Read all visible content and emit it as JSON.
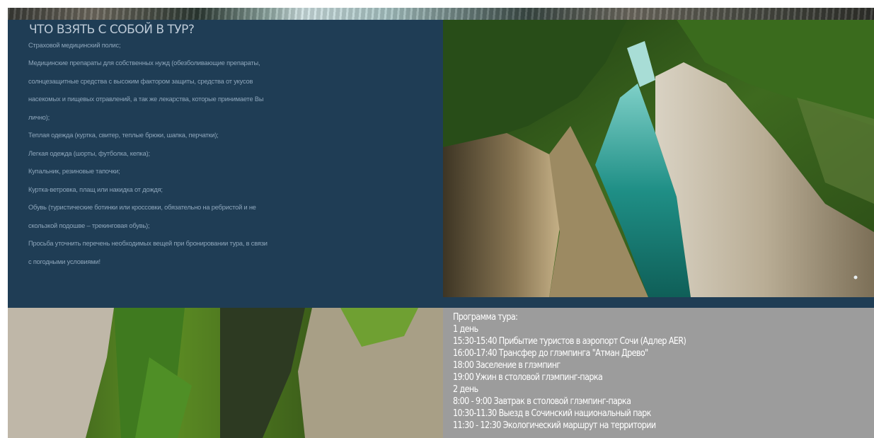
{
  "checklist": {
    "title": "ЧТО ВЗЯТЬ С СОБОЙ В ТУР?",
    "lines": [
      "Страховой медицинский полис;",
      "Медицинские препараты для собственных нужд (обезболивающие препараты,",
      "солнцезащитные средства с высоким фактором защиты, средства от укусов",
      "насекомых и пищевых отравлений, а так же лекарства, которые принимаете Вы",
      "лично);",
      "Теплая одежда (куртка, свитер, теплые брюки, шапка, перчатки);",
      "Легкая одежда (шорты, футболка, кепка);",
      "Купальник, резиновые тапочки;",
      "Куртка-ветровка, плащ или накидка от дождя;",
      "Обувь (туристические ботинки или кроссовки, обязательно на ребристой и не",
      "скользкой подошве – трекинговая обувь);",
      "Просьба уточнить перечень необходимых вещей при бронировании тура, в связи",
      "с погодными условиями!"
    ]
  },
  "program": {
    "lines": [
      "Программа тура:",
      "1 день",
      "15:30-15:40 Прибытие туристов в аэропорт Сочи (Адлер AER)",
      "16:00-17:40 Трансфер до глэмпинга \"Атман Древо\"",
      "18:00 Заселение в глэмпинг",
      "19:00 Ужин в столовой глэмпинг-парка",
      "2 день",
      "8:00 - 9:00 Завтрак в столовой глэмпинг-парка",
      "10:30-11.30 Выезд в Сочинский национальный парк",
      "11:30 - 12:30 Экологический маршрут на территории"
    ]
  },
  "images": {
    "top_strip": "river-landscape-photo",
    "canyon": "canyon-river-photo",
    "forest": "mossy-gorge-photo"
  },
  "colors": {
    "panel_bg": "#1f3d55",
    "panel_text": "#8ea6bb",
    "panel_title": "#bcc9d6",
    "program_bg": "#9c9c9c",
    "program_text": "#ffffff"
  }
}
